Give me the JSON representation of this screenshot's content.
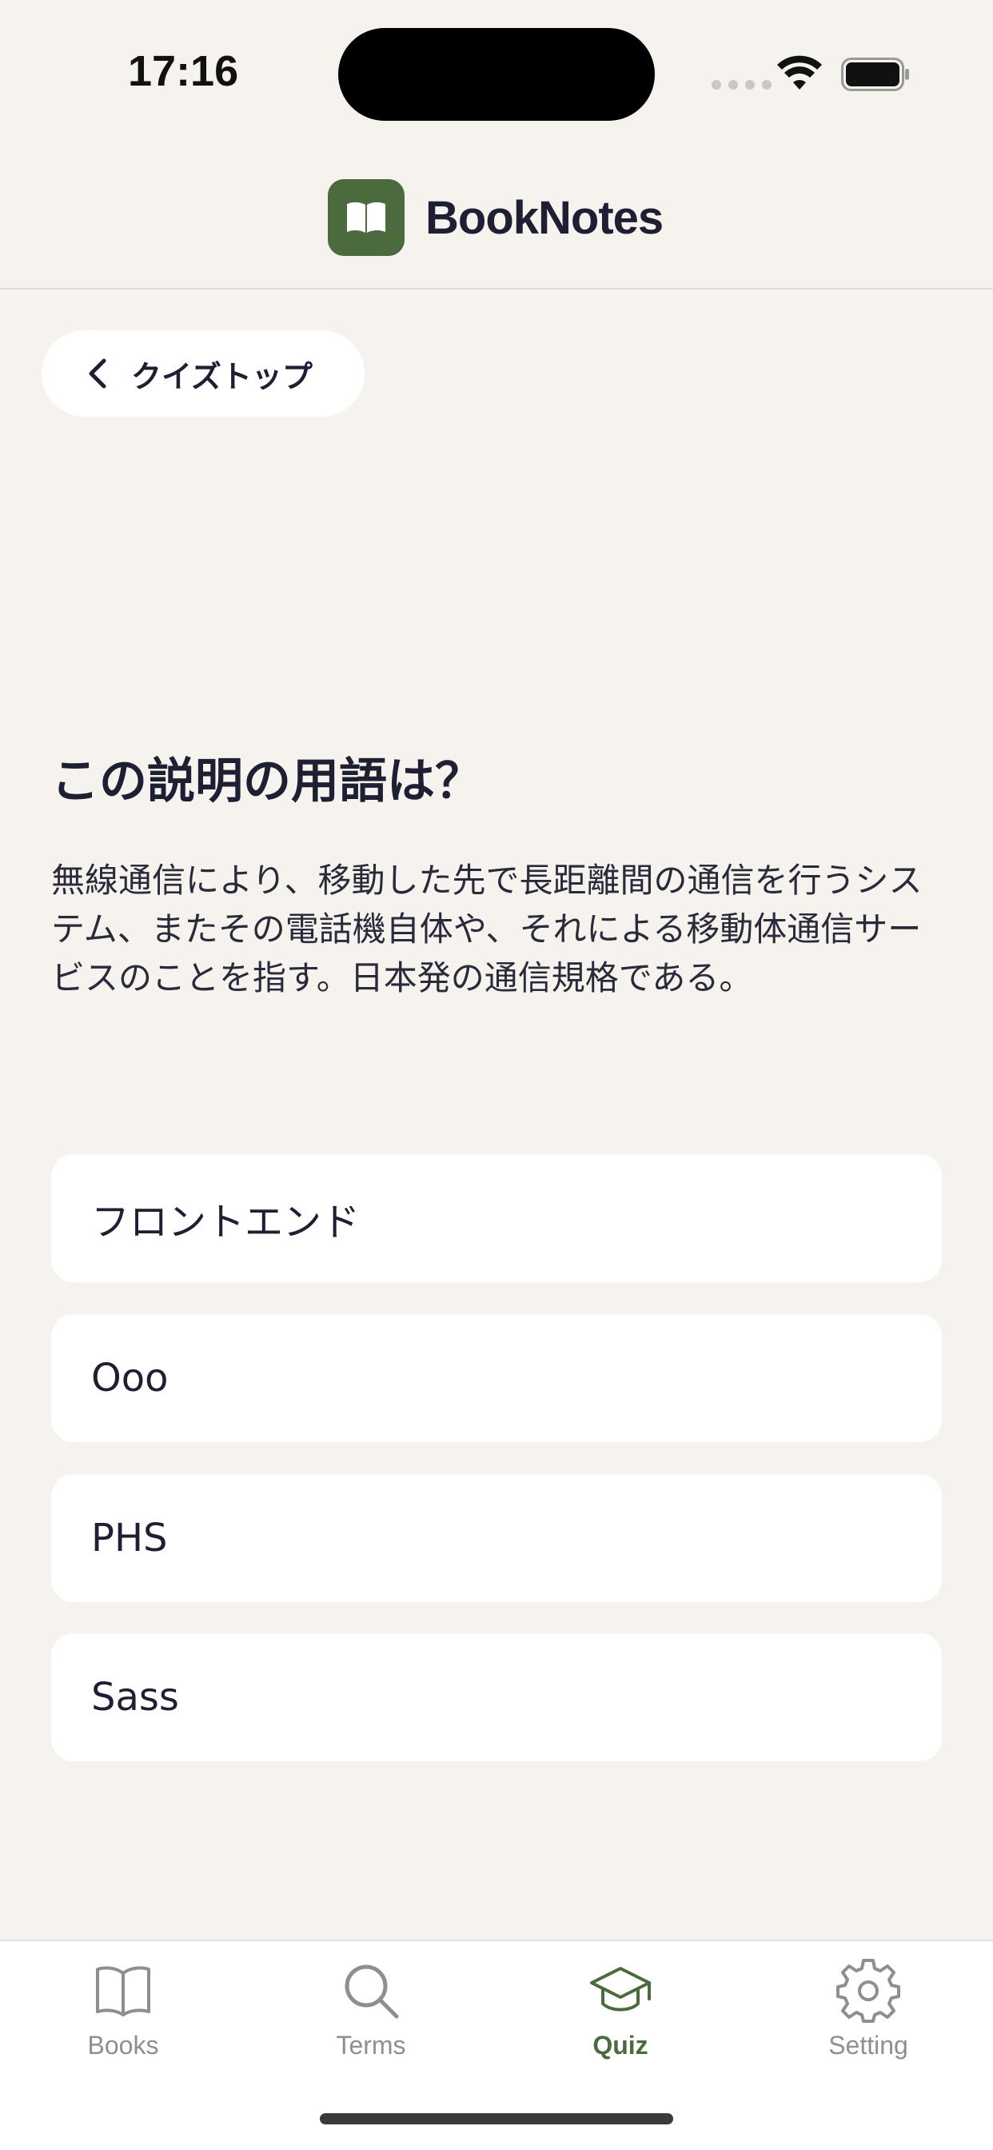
{
  "status_bar": {
    "time": "17:16"
  },
  "header": {
    "app_title": "BookNotes",
    "logo_icon": "open-book-icon",
    "brand_color": "#4b6b3f"
  },
  "back_button": {
    "label": "クイズトップ",
    "icon": "chevron-left-icon"
  },
  "quiz": {
    "question_title": "この説明の用語は？",
    "question_body": "無線通信により、移動した先で長距離間の通信を行うシステム、またその電話機自体や、それによる移動体通信サービスのことを指す。日本発の通信規格である。",
    "options": [
      "フロントエンド",
      "Ooo",
      "PHS",
      "Sass"
    ]
  },
  "tab_bar": {
    "active_color": "#4b6b3f",
    "inactive_color": "#8e8e93",
    "tabs": [
      {
        "label": "Books",
        "icon": "book-icon",
        "active": false
      },
      {
        "label": "Terms",
        "icon": "search-icon",
        "active": false
      },
      {
        "label": "Quiz",
        "icon": "graduation-cap-icon",
        "active": true
      },
      {
        "label": "Setting",
        "icon": "gear-icon",
        "active": false
      }
    ]
  }
}
